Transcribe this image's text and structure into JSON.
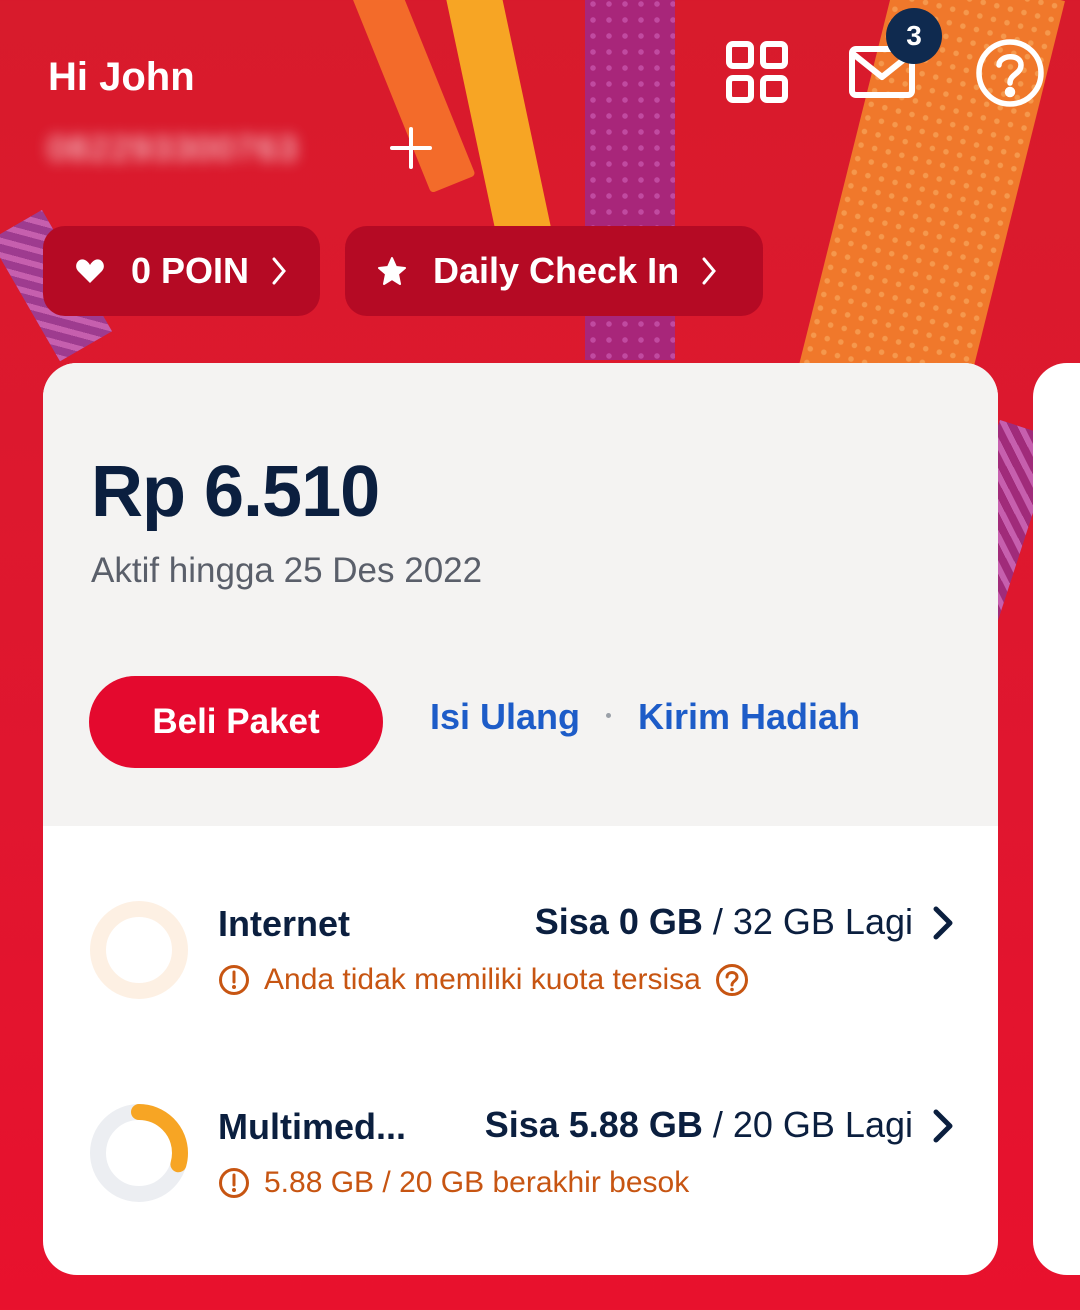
{
  "header": {
    "greeting": "Hi John",
    "phone_number": "082293300763",
    "inbox_count": "3"
  },
  "chips": {
    "points_label": "0 POIN",
    "checkin_label": "Daily Check In"
  },
  "balance_card": {
    "balance": "Rp 6.510",
    "active_until": "Aktif hingga 25 Des 2022",
    "buy_button": "Beli Paket",
    "refill_link": "Isi Ulang",
    "gift_link": "Kirim Hadiah"
  },
  "quotas": [
    {
      "name": "Internet",
      "remaining": "Sisa 0 GB",
      "separator": " / ",
      "total": "32 GB Lagi",
      "warning": "Anda tidak memiliki kuota tersisa",
      "fraction_used": 0
    },
    {
      "name": "Multimed...",
      "remaining": "Sisa 5.88 GB",
      "separator": " / ",
      "total": "20 GB Lagi",
      "warning": "5.88 GB / 20 GB berakhir besok",
      "fraction_remaining": 0.294
    }
  ],
  "colors": {
    "brand_red": "#e4092e",
    "navy": "#0b1f3f",
    "link_blue": "#1d5cc8",
    "warning_orange": "#c75512",
    "ring_orange": "#f7a524"
  }
}
